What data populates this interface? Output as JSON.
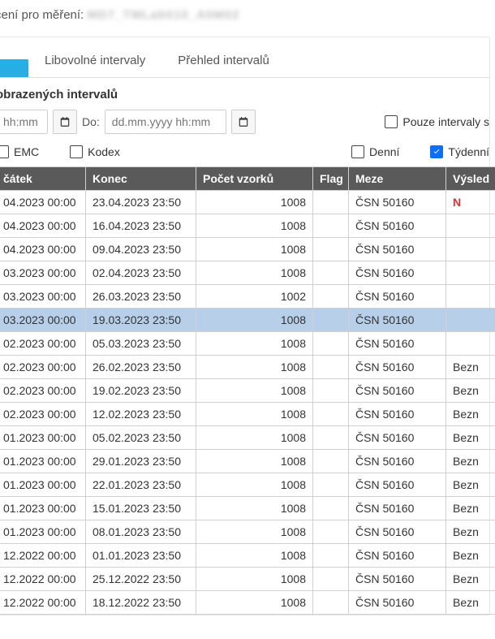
{
  "title_prefix": "cení pro měření:",
  "title_blurred": "MD7_TMLab010_A0M02",
  "tabs": {
    "active_hidden": "",
    "free_intervals": "Libovolné intervaly",
    "overview": "Přehled intervalů"
  },
  "section_caption": "obrazených intervalů",
  "filters": {
    "from_placeholder": "hh:mm",
    "to_label": "Do:",
    "to_placeholder": "dd.mm.yyyy hh:mm",
    "only_intervals_label": "Pouze intervaly s"
  },
  "check_row": {
    "emc": {
      "label": "EMC",
      "checked": false
    },
    "kodex": {
      "label": "Kodex",
      "checked": false
    },
    "denni": {
      "label": "Denní",
      "checked": false
    },
    "tydenni": {
      "label": "Týdenní",
      "checked": true
    }
  },
  "columns": {
    "start": "čátek",
    "end": "Konec",
    "count": "Počet vzorků",
    "flag": "Flag",
    "meze": "Meze",
    "result": "Výsled"
  },
  "rows": [
    {
      "start": "04.2023 00:00",
      "end": "23.04.2023 23:50",
      "count": 1008,
      "flag": "",
      "meze": "ČSN 50160",
      "result": "N",
      "result_red": true
    },
    {
      "start": "04.2023 00:00",
      "end": "16.04.2023 23:50",
      "count": 1008,
      "flag": "",
      "meze": "ČSN 50160",
      "result": ""
    },
    {
      "start": "04.2023 00:00",
      "end": "09.04.2023 23:50",
      "count": 1008,
      "flag": "",
      "meze": "ČSN 50160",
      "result": ""
    },
    {
      "start": "03.2023 00:00",
      "end": "02.04.2023 23:50",
      "count": 1008,
      "flag": "",
      "meze": "ČSN 50160",
      "result": ""
    },
    {
      "start": "03.2023 00:00",
      "end": "26.03.2023 23:50",
      "count": 1002,
      "flag": "",
      "meze": "ČSN 50160",
      "result": ""
    },
    {
      "start": "03.2023 00:00",
      "end": "19.03.2023 23:50",
      "count": 1008,
      "flag": "",
      "meze": "ČSN 50160",
      "result": "",
      "selected": true
    },
    {
      "start": "02.2023 00:00",
      "end": "05.03.2023 23:50",
      "count": 1008,
      "flag": "",
      "meze": "ČSN 50160",
      "result": ""
    },
    {
      "start": "02.2023 00:00",
      "end": "26.02.2023 23:50",
      "count": 1008,
      "flag": "",
      "meze": "ČSN 50160",
      "result": "Bezn"
    },
    {
      "start": "02.2023 00:00",
      "end": "19.02.2023 23:50",
      "count": 1008,
      "flag": "",
      "meze": "ČSN 50160",
      "result": "Bezn"
    },
    {
      "start": "02.2023 00:00",
      "end": "12.02.2023 23:50",
      "count": 1008,
      "flag": "",
      "meze": "ČSN 50160",
      "result": "Bezn"
    },
    {
      "start": "01.2023 00:00",
      "end": "05.02.2023 23:50",
      "count": 1008,
      "flag": "",
      "meze": "ČSN 50160",
      "result": "Bezn"
    },
    {
      "start": "01.2023 00:00",
      "end": "29.01.2023 23:50",
      "count": 1008,
      "flag": "",
      "meze": "ČSN 50160",
      "result": "Bezn"
    },
    {
      "start": "01.2023 00:00",
      "end": "22.01.2023 23:50",
      "count": 1008,
      "flag": "",
      "meze": "ČSN 50160",
      "result": "Bezn"
    },
    {
      "start": "01.2023 00:00",
      "end": "15.01.2023 23:50",
      "count": 1008,
      "flag": "",
      "meze": "ČSN 50160",
      "result": "Bezn"
    },
    {
      "start": "01.2023 00:00",
      "end": "08.01.2023 23:50",
      "count": 1008,
      "flag": "",
      "meze": "ČSN 50160",
      "result": "Bezn"
    },
    {
      "start": "12.2022 00:00",
      "end": "01.01.2023 23:50",
      "count": 1008,
      "flag": "",
      "meze": "ČSN 50160",
      "result": "Bezn"
    },
    {
      "start": "12.2022 00:00",
      "end": "25.12.2022 23:50",
      "count": 1008,
      "flag": "",
      "meze": "ČSN 50160",
      "result": "Bezn"
    },
    {
      "start": "12.2022 00:00",
      "end": "18.12.2022 23:50",
      "count": 1008,
      "flag": "",
      "meze": "ČSN 50160",
      "result": "Bezn"
    }
  ]
}
